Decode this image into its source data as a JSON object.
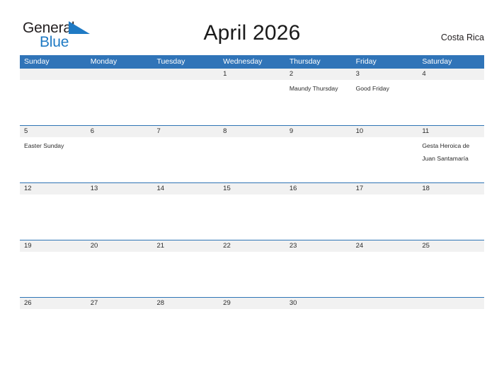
{
  "brand": {
    "name_dark": "General",
    "name_light": "Blue",
    "flag_color": "#1f7ac4"
  },
  "header": {
    "title": "April 2026",
    "country": "Costa Rica"
  },
  "theme": {
    "header_blue": "#3074b8",
    "row_line_blue": "#2e74b5",
    "date_band_gray": "#f1f1f1",
    "text_dark": "#2b2b2b"
  },
  "weekdays": [
    "Sunday",
    "Monday",
    "Tuesday",
    "Wednesday",
    "Thursday",
    "Friday",
    "Saturday"
  ],
  "weeks": [
    {
      "days": [
        {
          "date": "",
          "event": ""
        },
        {
          "date": "",
          "event": ""
        },
        {
          "date": "",
          "event": ""
        },
        {
          "date": "1",
          "event": ""
        },
        {
          "date": "2",
          "event": "Maundy Thursday"
        },
        {
          "date": "3",
          "event": "Good Friday"
        },
        {
          "date": "4",
          "event": ""
        }
      ]
    },
    {
      "days": [
        {
          "date": "5",
          "event": "Easter Sunday"
        },
        {
          "date": "6",
          "event": ""
        },
        {
          "date": "7",
          "event": ""
        },
        {
          "date": "8",
          "event": ""
        },
        {
          "date": "9",
          "event": ""
        },
        {
          "date": "10",
          "event": ""
        },
        {
          "date": "11",
          "event": "Gesta Heroica de Juan Santamaría"
        }
      ]
    },
    {
      "days": [
        {
          "date": "12",
          "event": ""
        },
        {
          "date": "13",
          "event": ""
        },
        {
          "date": "14",
          "event": ""
        },
        {
          "date": "15",
          "event": ""
        },
        {
          "date": "16",
          "event": ""
        },
        {
          "date": "17",
          "event": ""
        },
        {
          "date": "18",
          "event": ""
        }
      ]
    },
    {
      "days": [
        {
          "date": "19",
          "event": ""
        },
        {
          "date": "20",
          "event": ""
        },
        {
          "date": "21",
          "event": ""
        },
        {
          "date": "22",
          "event": ""
        },
        {
          "date": "23",
          "event": ""
        },
        {
          "date": "24",
          "event": ""
        },
        {
          "date": "25",
          "event": ""
        }
      ]
    },
    {
      "days": [
        {
          "date": "26",
          "event": ""
        },
        {
          "date": "27",
          "event": ""
        },
        {
          "date": "28",
          "event": ""
        },
        {
          "date": "29",
          "event": ""
        },
        {
          "date": "30",
          "event": ""
        },
        {
          "date": "",
          "event": ""
        },
        {
          "date": "",
          "event": ""
        }
      ]
    }
  ]
}
